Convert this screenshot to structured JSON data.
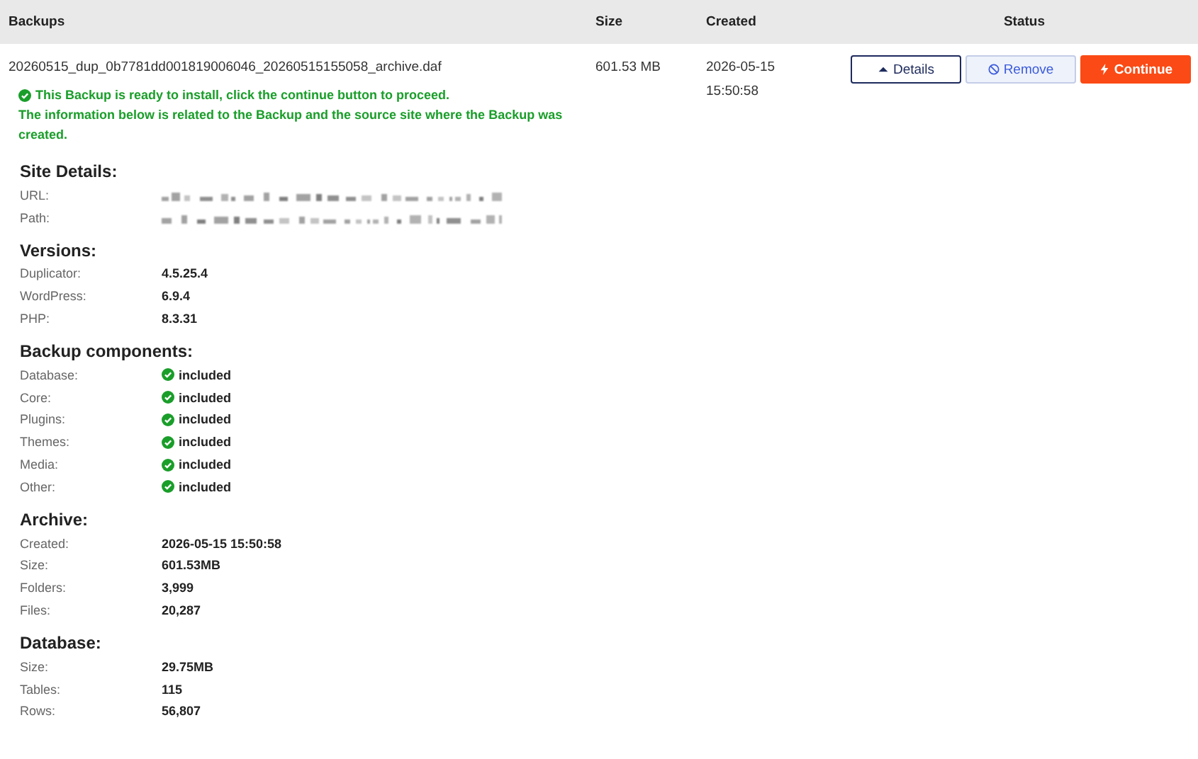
{
  "table": {
    "columns": [
      "Backups",
      "Size",
      "Created",
      "Status"
    ],
    "rows": [
      {
        "name": "20260515_dup_0b7781dd001819006046_20260515155058_archive.daf",
        "size": "601.53 MB",
        "created": [
          "2026-05-15",
          "15:50:58"
        ],
        "buttons": [
          {
            "label": "Details",
            "kind": "details"
          },
          {
            "label": "Remove",
            "kind": "remove"
          },
          {
            "label": "Continue",
            "kind": "continue"
          }
        ]
      }
    ]
  },
  "notice": {
    "lines": [
      "This Backup is ready to install, click the continue button to proceed.",
      "The information below is related to the Backup and the source site where the Backup was created."
    ]
  },
  "sections": [
    {
      "title": "Site Details:",
      "rows": [
        {
          "label": "URL:",
          "kind": "redacted"
        },
        {
          "label": "Path:",
          "kind": "redacted"
        }
      ]
    },
    {
      "title": "Versions:",
      "rows": [
        {
          "label": "Duplicator:",
          "kind": "text",
          "value": "4.5.25.4"
        },
        {
          "label": "WordPress:",
          "kind": "text",
          "value": "6.9.4"
        },
        {
          "label": "PHP:",
          "kind": "text",
          "value": "8.3.31"
        }
      ]
    },
    {
      "title": "Backup components:",
      "rows": [
        {
          "label": "Database:",
          "kind": "status",
          "value": "included"
        },
        {
          "label": "Core:",
          "kind": "status",
          "value": "included"
        },
        {
          "label": "Plugins:",
          "kind": "status",
          "value": "included"
        },
        {
          "label": "Themes:",
          "kind": "status",
          "value": "included"
        },
        {
          "label": "Media:",
          "kind": "status",
          "value": "included"
        },
        {
          "label": "Other:",
          "kind": "status",
          "value": "included"
        }
      ]
    },
    {
      "title": "Archive:",
      "rows": [
        {
          "label": "Created:",
          "kind": "text",
          "value": "2026-05-15 15:50:58"
        },
        {
          "label": "Size:",
          "kind": "text",
          "value": "601.53MB"
        },
        {
          "label": "Folders:",
          "kind": "text",
          "value": "3,999"
        },
        {
          "label": "Files:",
          "kind": "text",
          "value": "20,287"
        }
      ]
    },
    {
      "title": "Database:",
      "rows": [
        {
          "label": "Size:",
          "kind": "text",
          "value": "29.75MB"
        },
        {
          "label": "Tables:",
          "kind": "text",
          "value": "115"
        },
        {
          "label": "Rows:",
          "kind": "text",
          "value": "56,807"
        }
      ]
    }
  ]
}
